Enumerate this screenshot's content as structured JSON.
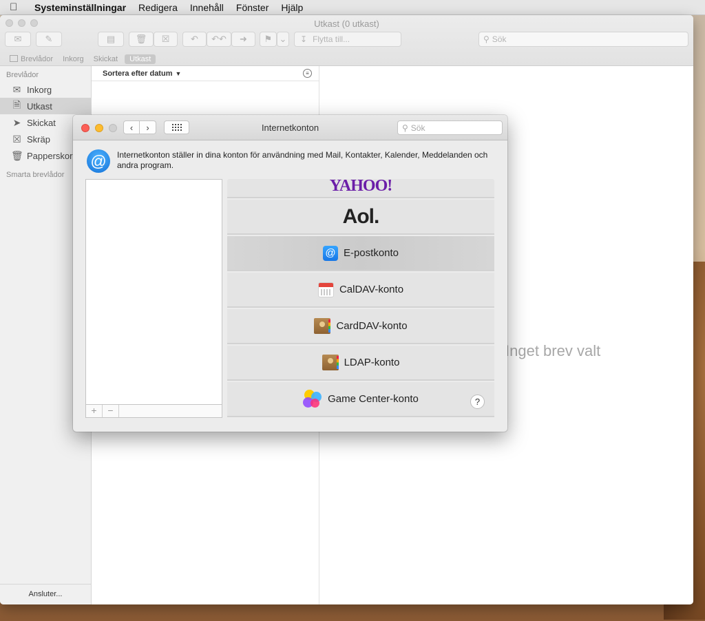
{
  "menubar": {
    "app": "Systeminställningar",
    "items": [
      "Redigera",
      "Innehåll",
      "Fönster",
      "Hjälp"
    ]
  },
  "mail": {
    "title": "Utkast (0 utkast)",
    "move_to": "Flytta till...",
    "search_placeholder": "Sök",
    "favorites": [
      "Brevlådor",
      "Inkorg",
      "Skickat",
      "Utkast"
    ],
    "sidebar_heading": "Brevlådor",
    "sidebar_items": [
      {
        "label": "Inkorg",
        "icon": "inbox-icon"
      },
      {
        "label": "Utkast",
        "icon": "drafts-icon"
      },
      {
        "label": "Skickat",
        "icon": "sent-icon"
      },
      {
        "label": "Skräp",
        "icon": "junk-icon"
      },
      {
        "label": "Papperskorg",
        "icon": "trash-icon"
      }
    ],
    "smart_mailboxes": "Smarta brevlådor",
    "status": "Ansluter...",
    "sort_label": "Sortera efter datum",
    "no_message": "Inget brev valt"
  },
  "prefs": {
    "title": "Internetkonton",
    "search_placeholder": "Sök",
    "description": "Internetkonton ställer in dina konton för användning med Mail, Kontakter, Kalender, Meddelanden och andra program.",
    "add_label": "+",
    "remove_label": "−",
    "help_label": "?",
    "providers": {
      "yahoo": "YAHOO!",
      "aol": "Aol.",
      "email": "E-postkonto",
      "caldav": "CalDAV-konto",
      "carddav": "CardDAV-konto",
      "ldap": "LDAP-konto",
      "gamecenter": "Game Center-konto"
    },
    "selected_provider": "E-postkonto"
  },
  "colors": {
    "close": "#fc5f57",
    "minimize": "#fdbc2e",
    "accent": "#1877e6"
  }
}
